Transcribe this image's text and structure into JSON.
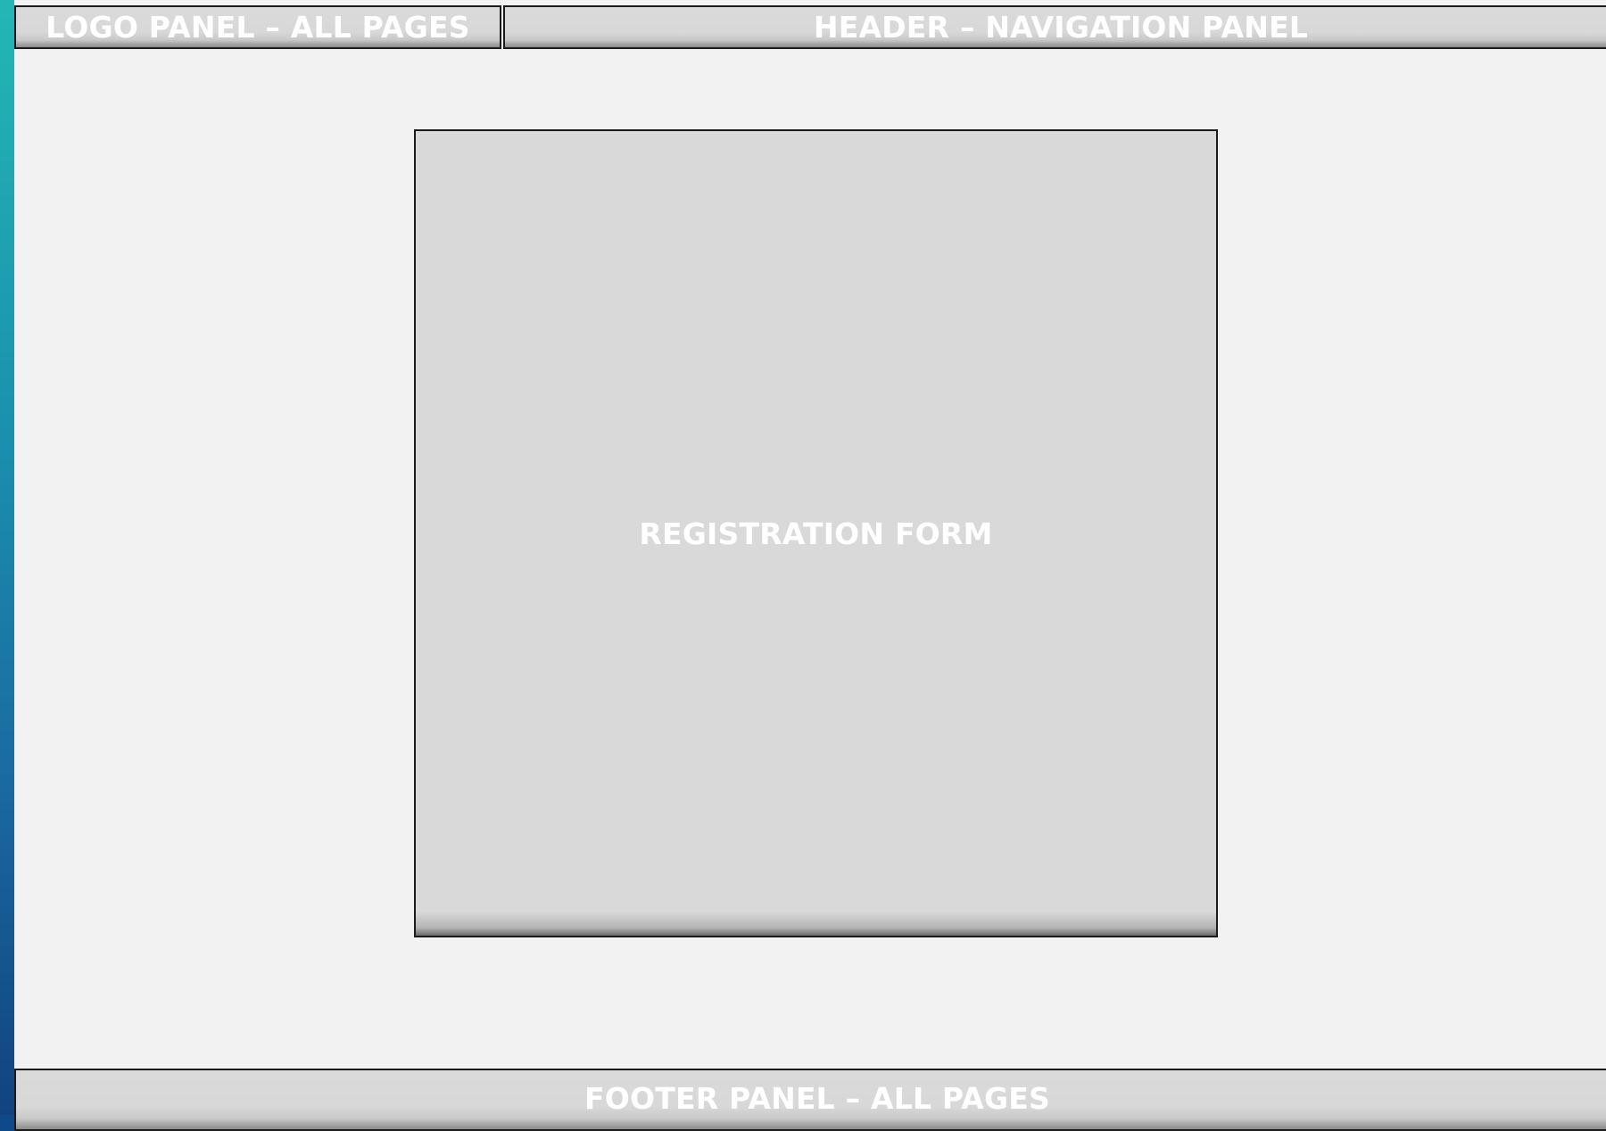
{
  "panels": {
    "logo": "LOGO PANEL – ALL PAGES",
    "header": "HEADER – NAVIGATION PANEL",
    "main": "REGISTRATION FORM",
    "footer": "FOOTER PANEL – ALL PAGES"
  },
  "colors": {
    "panel_fill": "#d9d9d9",
    "panel_border": "#1b1b1b",
    "panel_text": "#ffffff",
    "canvas_background": "#f2f2f2",
    "accent_strip": "#1a8fae"
  }
}
